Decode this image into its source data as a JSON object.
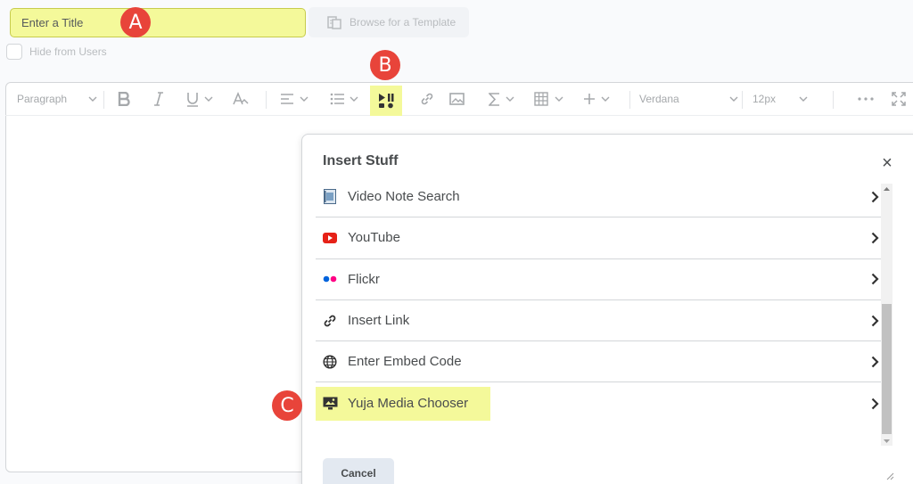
{
  "header": {
    "title_placeholder": "Enter a Title",
    "template_button": "Browse for a Template",
    "hide_label": "Hide from Users"
  },
  "badges": {
    "a": "A",
    "b": "B",
    "c": "C"
  },
  "toolbar": {
    "format": "Paragraph",
    "font": "Verdana",
    "size": "12px"
  },
  "dialog": {
    "title": "Insert Stuff",
    "close": "×",
    "items": [
      {
        "label": "Video Note Search",
        "icon": "video-note-icon"
      },
      {
        "label": "YouTube",
        "icon": "youtube-icon"
      },
      {
        "label": "Flickr",
        "icon": "flickr-icon"
      },
      {
        "label": "Insert Link",
        "icon": "link-icon"
      },
      {
        "label": "Enter Embed Code",
        "icon": "globe-icon"
      },
      {
        "label": "Yuja Media Chooser",
        "icon": "monitor-image-icon"
      }
    ],
    "cancel": "Cancel"
  },
  "colors": {
    "highlight": "#f4f99a",
    "badge": "#e8443a",
    "youtube": "#e62117",
    "flickr_blue": "#0063dc",
    "flickr_pink": "#ff0084"
  }
}
